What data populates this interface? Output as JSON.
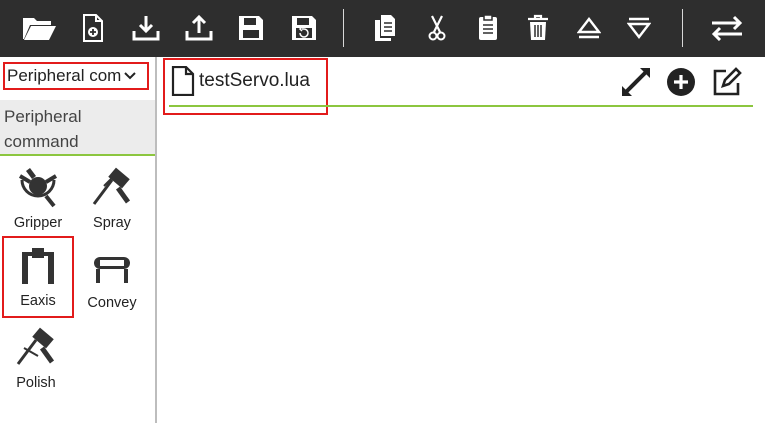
{
  "toolbar": {
    "items": [
      {
        "name": "open-folder",
        "icon": "folder-open-icon"
      },
      {
        "name": "new-file",
        "icon": "file-plus-icon"
      },
      {
        "name": "import",
        "icon": "download-icon"
      },
      {
        "name": "export",
        "icon": "upload-icon"
      },
      {
        "name": "save",
        "icon": "floppy-disk-icon"
      },
      {
        "name": "save-as",
        "icon": "floppy-disk-undo-icon"
      },
      {
        "name": "copy",
        "icon": "copy-icon"
      },
      {
        "name": "cut",
        "icon": "scissors-icon"
      },
      {
        "name": "paste",
        "icon": "clipboard-icon"
      },
      {
        "name": "delete",
        "icon": "trash-icon"
      },
      {
        "name": "move-up",
        "icon": "eject-up-icon"
      },
      {
        "name": "move-down",
        "icon": "eject-down-icon"
      },
      {
        "name": "switch",
        "icon": "swap-arrows-icon"
      }
    ]
  },
  "sidebar": {
    "dropdown_value": "Peripheral com",
    "section_title": "Peripheral command",
    "tools": [
      {
        "label": "Gripper",
        "icon": "gripper-icon"
      },
      {
        "label": "Spray",
        "icon": "spray-gun-icon"
      },
      {
        "label": "Eaxis",
        "icon": "linear-axis-icon",
        "selected": true
      },
      {
        "label": "Convey",
        "icon": "conveyor-icon"
      },
      {
        "label": "Polish",
        "icon": "polish-icon"
      }
    ]
  },
  "editor": {
    "file_name": "testServo.lua",
    "actions": [
      {
        "name": "expand",
        "icon": "expand-arrows-icon"
      },
      {
        "name": "add",
        "icon": "plus-circle-icon"
      },
      {
        "name": "edit",
        "icon": "edit-pencil-icon"
      }
    ]
  },
  "colors": {
    "toolbar_bg": "#2e2e2e",
    "accent_green": "#8cc63f",
    "highlight_red": "#e21b1b",
    "section_bg": "#ececec"
  }
}
